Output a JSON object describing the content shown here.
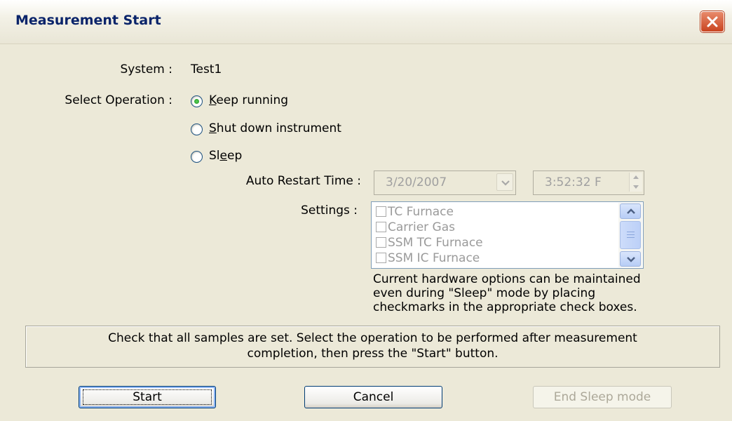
{
  "window": {
    "title": "Measurement Start",
    "accent": "#0A246A",
    "close_color": "#D0502A"
  },
  "system": {
    "label": "System :",
    "value": "Test1"
  },
  "operation": {
    "label": "Select Operation :",
    "options": [
      {
        "pre": "",
        "ul": "K",
        "post": "eep running",
        "selected": true
      },
      {
        "pre": "",
        "ul": "S",
        "post": "hut down instrument",
        "selected": false
      },
      {
        "pre": "Sl",
        "ul": "e",
        "post": "ep",
        "selected": false
      }
    ]
  },
  "restart": {
    "label": "Auto Restart Time :",
    "date": "3/20/2007",
    "time": "3:52:32 F"
  },
  "settings": {
    "label": "Settings :",
    "items": [
      "TC Furnace",
      "Carrier Gas",
      "SSM TC Furnace",
      "SSM IC Furnace"
    ],
    "note": [
      "Current hardware options can be maintained",
      "even during \"Sleep\" mode by placing",
      "checkmarks in the appropriate check boxes."
    ]
  },
  "info": {
    "lines": [
      "Check that all samples are set. Select the operation to be performed after measurement",
      "completion, then press the \"Start\" button."
    ]
  },
  "buttons": {
    "start": "Start",
    "cancel": "Cancel",
    "end_sleep": "End Sleep mode"
  },
  "icons": {
    "close": "close-x-icon",
    "dropdown": "chevron-down-icon",
    "spin_up": "triangle-up-icon",
    "spin_down": "triangle-down-icon"
  }
}
